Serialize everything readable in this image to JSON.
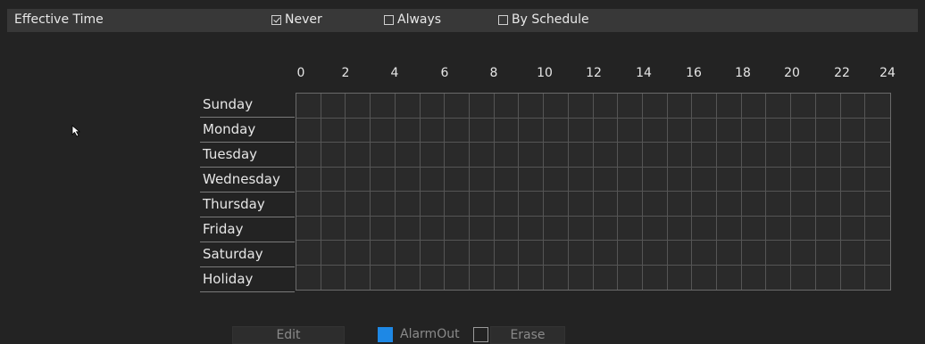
{
  "header": {
    "title": "Effective Time",
    "options": [
      {
        "label": "Never",
        "checked": true
      },
      {
        "label": "Always",
        "checked": false
      },
      {
        "label": "By Schedule",
        "checked": false
      }
    ]
  },
  "schedule": {
    "hours": [
      "0",
      "2",
      "4",
      "6",
      "8",
      "10",
      "12",
      "14",
      "16",
      "18",
      "20",
      "22",
      "24"
    ],
    "days": [
      "Sunday",
      "Monday",
      "Tuesday",
      "Wednesday",
      "Thursday",
      "Friday",
      "Saturday",
      "Holiday"
    ]
  },
  "footer": {
    "edit_label": "Edit",
    "alarmout_label": "AlarmOut",
    "erase_label": "Erase"
  },
  "colors": {
    "alarmout": "#1e88e5",
    "erase": "#222222"
  }
}
